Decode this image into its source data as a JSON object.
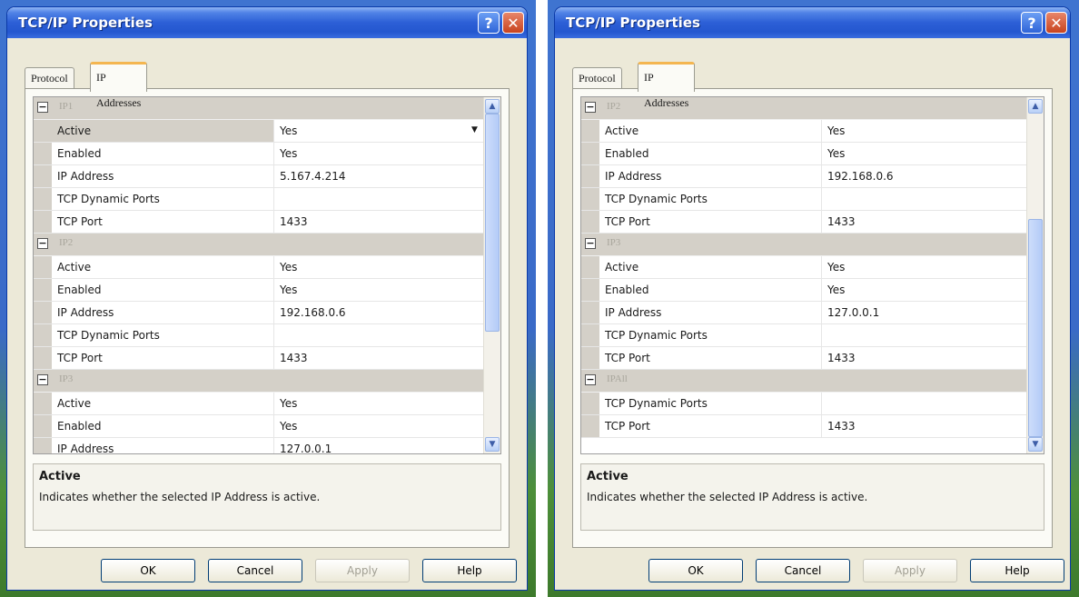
{
  "windows": [
    {
      "title": "TCP/IP Properties",
      "tabs": [
        "Protocol",
        "IP Addresses"
      ],
      "groups": [
        {
          "name": "IP1",
          "props": [
            {
              "name": "Active",
              "value": "Yes",
              "selected": true
            },
            {
              "name": "Enabled",
              "value": "Yes"
            },
            {
              "name": "IP Address",
              "value": "5.167.4.214"
            },
            {
              "name": "TCP Dynamic Ports",
              "value": ""
            },
            {
              "name": "TCP Port",
              "value": "1433"
            }
          ]
        },
        {
          "name": "IP2",
          "props": [
            {
              "name": "Active",
              "value": "Yes"
            },
            {
              "name": "Enabled",
              "value": "Yes"
            },
            {
              "name": "IP Address",
              "value": "192.168.0.6"
            },
            {
              "name": "TCP Dynamic Ports",
              "value": ""
            },
            {
              "name": "TCP Port",
              "value": "1433"
            }
          ]
        },
        {
          "name": "IP3",
          "props": [
            {
              "name": "Active",
              "value": "Yes"
            },
            {
              "name": "Enabled",
              "value": "Yes"
            },
            {
              "name": "IP Address",
              "value": "127.0.0.1"
            }
          ]
        }
      ],
      "scroll_fraction": 0.0,
      "description": {
        "title": "Active",
        "text": "Indicates whether the selected IP Address is active."
      },
      "buttons": {
        "ok": "OK",
        "cancel": "Cancel",
        "apply": "Apply",
        "help": "Help"
      }
    },
    {
      "title": "TCP/IP Properties",
      "tabs": [
        "Protocol",
        "IP Addresses"
      ],
      "groups": [
        {
          "name": "IP2",
          "props": [
            {
              "name": "Active",
              "value": "Yes"
            },
            {
              "name": "Enabled",
              "value": "Yes"
            },
            {
              "name": "IP Address",
              "value": "192.168.0.6"
            },
            {
              "name": "TCP Dynamic Ports",
              "value": ""
            },
            {
              "name": "TCP Port",
              "value": "1433"
            }
          ]
        },
        {
          "name": "IP3",
          "props": [
            {
              "name": "Active",
              "value": "Yes"
            },
            {
              "name": "Enabled",
              "value": "Yes"
            },
            {
              "name": "IP Address",
              "value": "127.0.0.1"
            },
            {
              "name": "TCP Dynamic Ports",
              "value": ""
            },
            {
              "name": "TCP Port",
              "value": "1433"
            }
          ]
        },
        {
          "name": "IPAll",
          "props": [
            {
              "name": "TCP Dynamic Ports",
              "value": ""
            },
            {
              "name": "TCP Port",
              "value": "1433"
            }
          ]
        }
      ],
      "scroll_fraction": 1.0,
      "description": {
        "title": "Active",
        "text": "Indicates whether the selected IP Address is active."
      },
      "buttons": {
        "ok": "OK",
        "cancel": "Cancel",
        "apply": "Apply",
        "help": "Help"
      }
    }
  ]
}
